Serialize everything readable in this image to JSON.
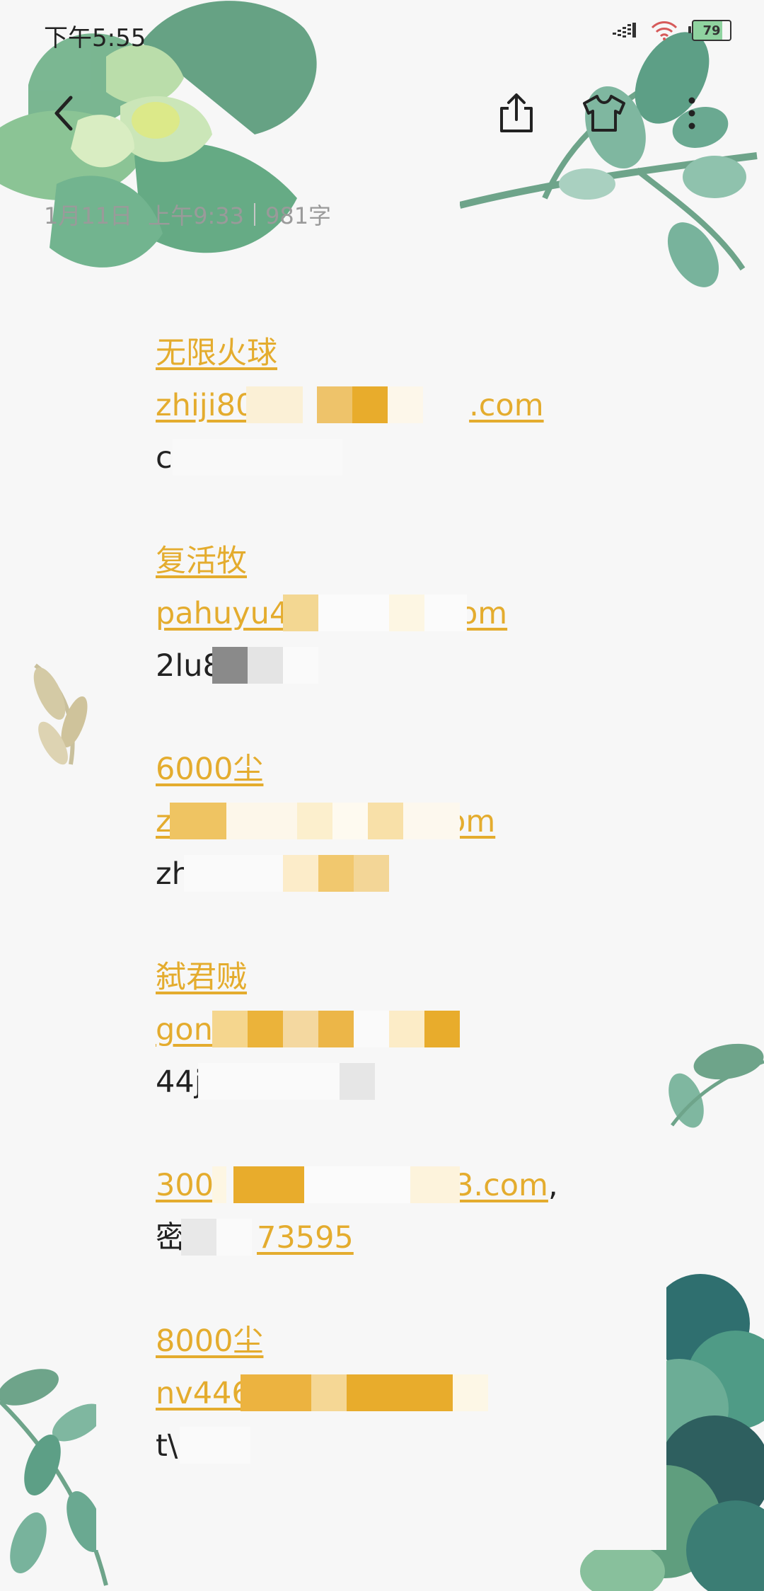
{
  "status_bar": {
    "time": "下午5:55",
    "battery": "79"
  },
  "toolbar": {
    "back_icon": "chevron-left-icon",
    "share_icon": "share-icon",
    "theme_icon": "tshirt-icon",
    "more_icon": "more-vertical-icon"
  },
  "note_meta": {
    "date": "1月11日",
    "time": "上午9:33",
    "word_count": "981字"
  },
  "entries": [
    {
      "title": "无限火球",
      "account": "zhiji8056",
      "account_suffix": ".com",
      "password": "c"
    },
    {
      "title": "复活牧",
      "account": "pahuyu462",
      "account_suffix": "om",
      "password": "2lu8"
    },
    {
      "title": "6000尘",
      "account": "zongjiao74",
      "account_suffix": ".com",
      "password": "zh"
    },
    {
      "title": "弑君贼",
      "account": "gongchm",
      "account_suffix": "",
      "password": "44j"
    },
    {
      "title": "300",
      "account": "3.com",
      "comma": ",",
      "password_prefix": "密",
      "password": "73595"
    },
    {
      "title": "8000尘",
      "account": "nv4468750",
      "account_suffix": "",
      "password": "t\\"
    }
  ],
  "colors": {
    "link": "#e4ac2e",
    "text": "#222222",
    "meta": "#9a9a9a",
    "background": "#f7f7f7"
  }
}
